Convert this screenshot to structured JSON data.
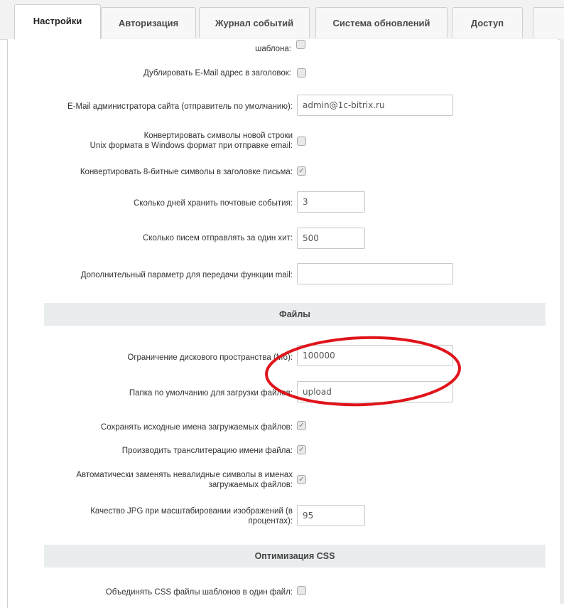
{
  "tabs": [
    {
      "label": "Настройки",
      "active": true
    },
    {
      "label": "Авторизация",
      "active": false
    },
    {
      "label": "Журнал событий",
      "active": false
    },
    {
      "label": "Система обновлений",
      "active": false
    },
    {
      "label": "Доступ",
      "active": false
    }
  ],
  "mail": {
    "template_suffix_label": "шаблона:",
    "duplicate_email_label": "Дублировать E-Mail адрес в заголовок:",
    "admin_email_label": "E-Mail администратора сайта (отправитель по умолчанию):",
    "admin_email_value": "admin@1c-bitrix.ru",
    "convert_newlines_label_1": "Конвертировать символы новой строки",
    "convert_newlines_label_2": "Unix формата в Windows формат при отправке email:",
    "convert_8bit_label": "Конвертировать 8-битные символы в заголовке письма:",
    "convert_8bit_checked": true,
    "days_keep_label": "Сколько дней хранить почтовые события:",
    "days_keep_value": "3",
    "per_hit_label": "Сколько писем отправлять за один хит:",
    "per_hit_value": "500",
    "extra_param_label": "Дополнительный параметр для передачи функции mail:",
    "extra_param_value": ""
  },
  "files": {
    "section_title": "Файлы",
    "disk_limit_label": "Ограничение дискового пространства (Мб):",
    "disk_limit_value": "100000",
    "upload_dir_label": "Папка по умолчанию для загрузки файлов:",
    "upload_dir_value": "upload",
    "keep_names_label": "Сохранять исходные имена загружаемых файлов:",
    "keep_names_checked": true,
    "transliterate_label": "Производить транслитерацию имени файла:",
    "transliterate_checked": true,
    "replace_invalid_label_1": "Автоматически заменять невалидные символы в именах",
    "replace_invalid_label_2": "загружаемых файлов:",
    "replace_invalid_checked": true,
    "jpg_quality_label_1": "Качество JPG при масштабировании изображений (в",
    "jpg_quality_label_2": "процентах):",
    "jpg_quality_value": "95"
  },
  "css": {
    "section_title": "Оптимизация CSS",
    "combine_css_label": "Объединять CSS файлы шаблонов в один файл:"
  },
  "colors": {
    "annotation": "#e0141b",
    "section_bg": "#e9edee",
    "checkbox_bg": "#e9e9e9"
  }
}
